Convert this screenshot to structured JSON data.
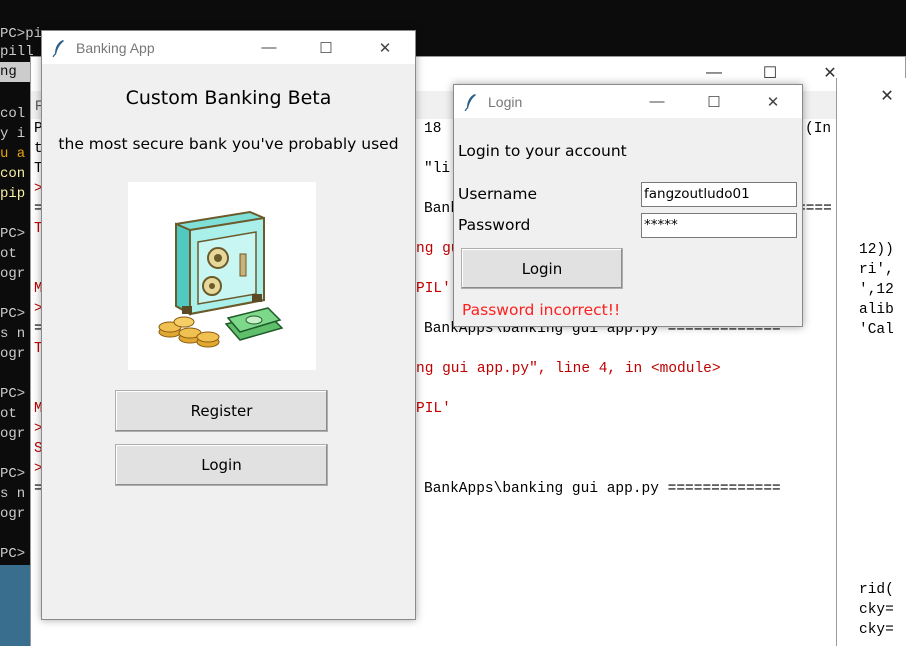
{
  "console": {
    "lines": [
      {
        "text": "PC>pi",
        "cls": ""
      },
      {
        "text": "pill",
        "cls": ""
      },
      {
        "text": "ng ",
        "cls": ""
      },
      {
        "text": "col",
        "cls": ""
      },
      {
        "text": "y i",
        "cls": ""
      },
      {
        "text": "u a",
        "cls": "orange"
      },
      {
        "text": "con",
        "cls": "yellow"
      },
      {
        "text": "pip",
        "cls": "yellow"
      },
      {
        "text": "PC>",
        "cls": ""
      },
      {
        "text": "ot",
        "cls": ""
      },
      {
        "text": "ogr",
        "cls": ""
      },
      {
        "text": "PC>",
        "cls": ""
      },
      {
        "text": "s n",
        "cls": ""
      },
      {
        "text": "ogr",
        "cls": ""
      },
      {
        "text": "PC>",
        "cls": ""
      },
      {
        "text": "ot",
        "cls": ""
      },
      {
        "text": "ogr",
        "cls": ""
      },
      {
        "text": "PC>",
        "cls": ""
      },
      {
        "text": "s n",
        "cls": ""
      },
      {
        "text": "ogr",
        "cls": ""
      },
      {
        "text": "PC>",
        "cls": ""
      }
    ],
    "scrollband_text": "ng "
  },
  "shell": {
    "menu_first": "F",
    "lines": [
      {
        "text": "P",
        "cls": ""
      },
      {
        "text": "t",
        "cls": ""
      },
      {
        "text": "T",
        "cls": ""
      },
      {
        "text": ">",
        "cls": "red"
      },
      {
        "text": "=",
        "cls": ""
      },
      {
        "text": "T",
        "cls": "red"
      },
      {
        "text": "M",
        "cls": "red"
      },
      {
        "text": ">",
        "cls": "red"
      },
      {
        "text": "=",
        "cls": ""
      },
      {
        "text": "T",
        "cls": "red"
      },
      {
        "text": "M",
        "cls": "red"
      },
      {
        "text": ">",
        "cls": "red"
      },
      {
        "text": "S",
        "cls": "red"
      },
      {
        "text": ">",
        "cls": "red"
      },
      {
        "text": "=",
        "cls": ""
      }
    ],
    "mid_lines": [
      {
        "text": "18",
        "cls": ""
      },
      {
        "text": "\"li",
        "cls": ""
      },
      {
        "text": "Bank",
        "cls": ""
      },
      {
        "text": "ng gu",
        "cls": "red"
      },
      {
        "text": "PIL'",
        "cls": "red"
      },
      {
        "text": "BankApps\\banking gui app.py =============",
        "cls": ""
      },
      {
        "text": "ng gui app.py\", line 4, in <module>",
        "cls": "red"
      },
      {
        "text": "PIL'",
        "cls": "red"
      },
      {
        "text": "BankApps\\banking gui app.py =============",
        "cls": ""
      }
    ],
    "right_lines": [
      {
        "text": "(In",
        "cls": ""
      },
      {
        "text": "====",
        "cls": ""
      }
    ]
  },
  "right_window": {
    "lines": [
      {
        "text": "12))",
        "cls": ""
      },
      {
        "text": "ri',",
        "cls": "green"
      },
      {
        "text": "',12",
        "cls": "green"
      },
      {
        "text": "alib",
        "cls": "green"
      },
      {
        "text": "'Cal",
        "cls": "green"
      },
      {
        "text": "rid(",
        "cls": ""
      },
      {
        "text": "cky=",
        "cls": ""
      },
      {
        "text": "cky=",
        "cls": ""
      }
    ]
  },
  "bank_window": {
    "title": "Banking App",
    "heading": "Custom Banking Beta",
    "tagline": "the most secure bank you've probably used",
    "register_label": "Register",
    "login_label": "Login"
  },
  "login_window": {
    "title": "Login",
    "prompt": "Login to your account",
    "username_label": "Username",
    "username_value": "fangzoutludo01",
    "password_label": "Password",
    "password_value": "*****",
    "login_label": "Login",
    "error": "Password incorrect!!"
  },
  "caption": {
    "minimize": "—",
    "maximize": "☐",
    "close": "✕"
  }
}
